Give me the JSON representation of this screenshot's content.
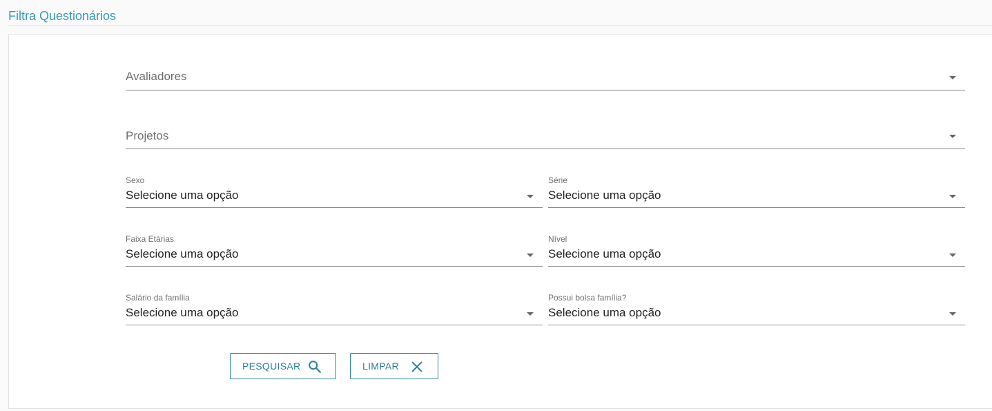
{
  "header": {
    "title": "Filtra Questionários"
  },
  "filters": {
    "avaliadores": {
      "placeholder": "Avaliadores"
    },
    "projetos": {
      "placeholder": "Projetos"
    },
    "sexo": {
      "label": "Sexo",
      "value": "Selecione uma opção"
    },
    "serie": {
      "label": "Série",
      "value": "Selecione uma opção"
    },
    "faixa_etarias": {
      "label": "Faixa Etárias",
      "value": "Selecione uma opção"
    },
    "nivel": {
      "label": "Nível",
      "value": "Selecione uma opção"
    },
    "salario_familia": {
      "label": "Salário da família",
      "value": "Selecione uma opção"
    },
    "bolsa_familia": {
      "label": "Possui bolsa família?",
      "value": "Selecione uma opção"
    }
  },
  "actions": {
    "search_label": "PESQUISAR",
    "search_icon": "search-icon",
    "clear_label": "LIMPAR",
    "clear_icon": "close-icon"
  },
  "colors": {
    "accent": "#3399b8",
    "button": "#2a7f9a"
  }
}
